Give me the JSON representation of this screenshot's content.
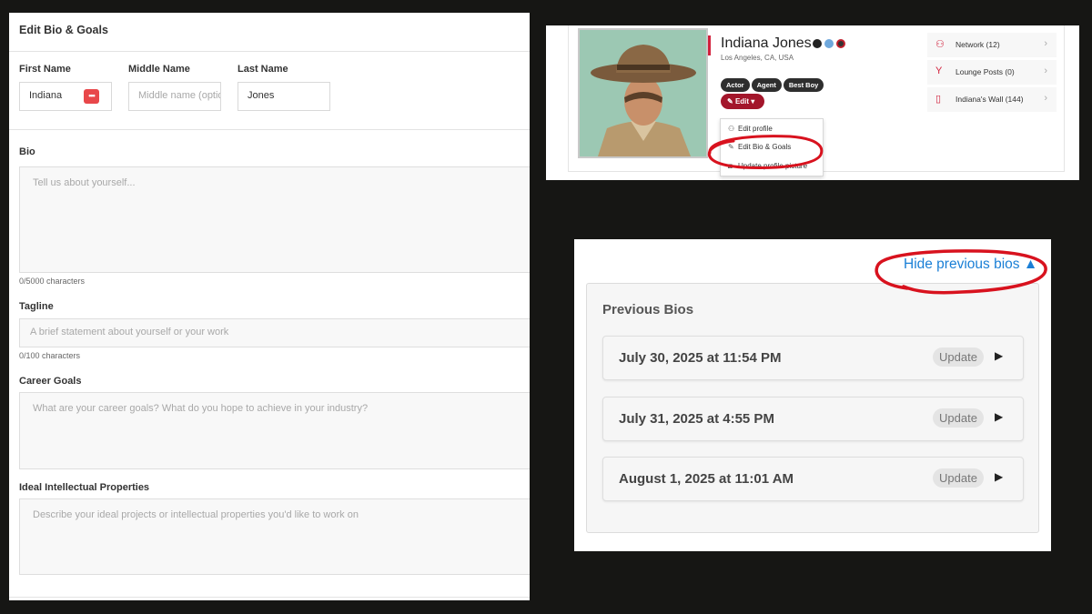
{
  "edit_form": {
    "title": "Edit Bio & Goals",
    "first_name": {
      "label": "First Name",
      "value": "Indiana"
    },
    "middle_name": {
      "label": "Middle Name",
      "placeholder": "Middle name (optional)"
    },
    "last_name": {
      "label": "Last Name",
      "value": "Jones"
    },
    "bio": {
      "label": "Bio",
      "placeholder": "Tell us about yourself...",
      "counter": "0/5000 characters"
    },
    "tagline": {
      "label": "Tagline",
      "placeholder": "A brief statement about yourself or your work",
      "counter": "0/100 characters"
    },
    "career_goals": {
      "label": "Career Goals",
      "placeholder": "What are your career goals? What do you hope to achieve in your industry?"
    },
    "ideal_ip": {
      "label": "Ideal Intellectual Properties",
      "placeholder": "Describe your ideal projects or intellectual properties you'd like to work on"
    }
  },
  "profile": {
    "name": "Indiana Jones",
    "location": "Los Angeles, CA, USA",
    "tags": [
      "Actor",
      "Agent",
      "Best Boy"
    ],
    "edit_label": "Edit",
    "dropdown": [
      "Edit profile",
      "Edit Bio & Goals",
      "Update profile picture"
    ],
    "side_links": [
      {
        "label": "Network (12)",
        "icon": "people-icon"
      },
      {
        "label": "Lounge Posts (0)",
        "icon": "cocktail-icon"
      },
      {
        "label": "Indiana's Wall (144)",
        "icon": "book-icon"
      }
    ]
  },
  "previous_bios": {
    "toggle_label": "Hide previous bios ▲",
    "title": "Previous Bios",
    "items": [
      {
        "date": "July 30, 2025 at 11:54 PM",
        "action": "Update"
      },
      {
        "date": "July 31, 2025 at 4:55 PM",
        "action": "Update"
      },
      {
        "date": "August 1, 2025 at 11:01 AM",
        "action": "Update"
      }
    ]
  },
  "colors": {
    "accent_red": "#d2223d",
    "edit_button": "#a3162b",
    "link_blue": "#1a7fd6",
    "annotation_red": "#d8121e"
  }
}
